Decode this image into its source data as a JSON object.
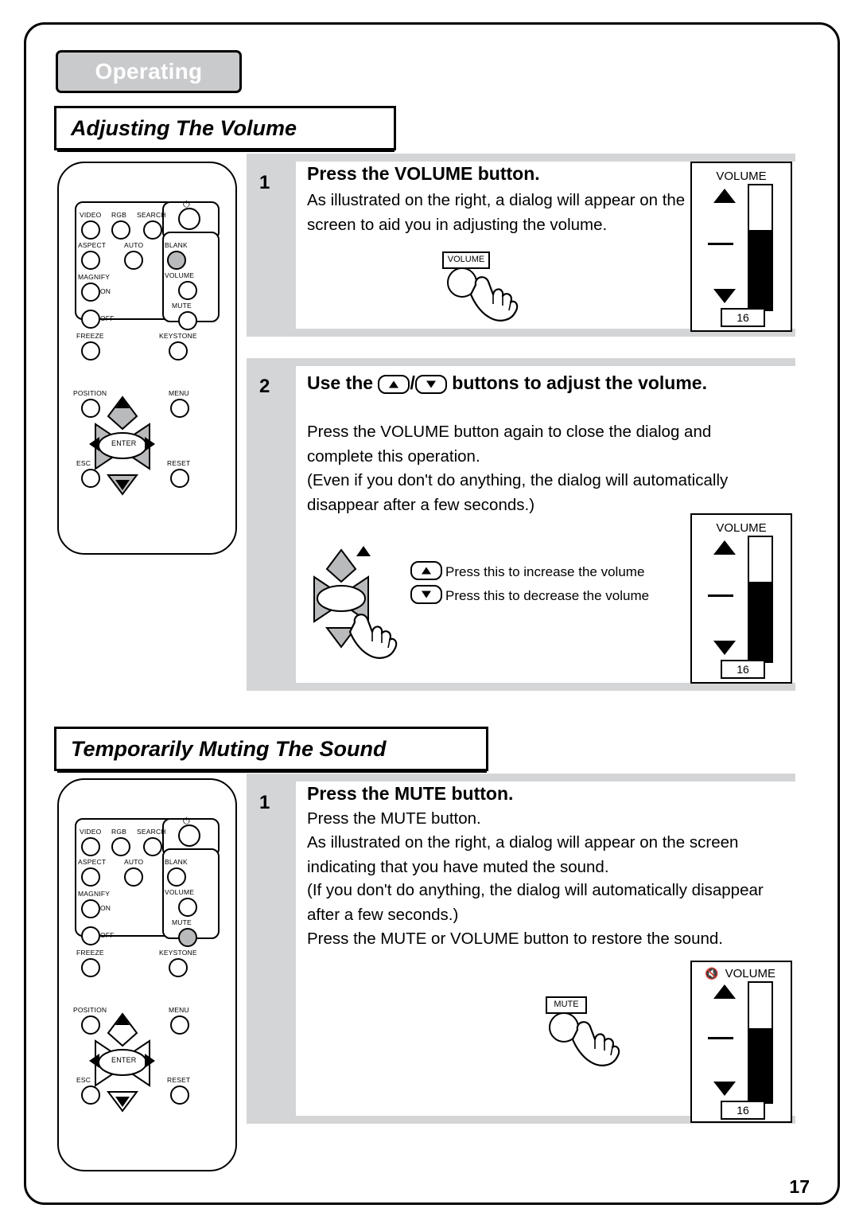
{
  "document": {
    "chapter": "Operating",
    "page_number": "17"
  },
  "sections": [
    {
      "id": "volume",
      "title": "Adjusting The Volume"
    },
    {
      "id": "mute",
      "title": "Temporarily Muting The Sound"
    }
  ],
  "steps": {
    "volume_step1": {
      "number": "1",
      "heading": "Press the VOLUME button.",
      "body": "As illustrated on the right, a dialog will appear on the screen to aid you in adjusting the volume."
    },
    "volume_step2": {
      "number": "2",
      "heading_pre": "Use the ",
      "heading_mid": "/",
      "heading_post": " buttons to adjust the volume.",
      "body_line1": "Press the VOLUME button again to close the dialog and complete this operation.",
      "body_line2": "(Even if you don't do anything, the dialog will automatically disappear after a few seconds.)",
      "legend_up": "Press this to increase the volume",
      "legend_down": "Press this to decrease the volume"
    },
    "mute_step1": {
      "number": "1",
      "heading": "Press the MUTE button.",
      "body_line1": "Press the MUTE button.",
      "body_line2": "As illustrated on the right, a dialog will appear on the screen indicating that you have muted the sound.",
      "body_line3": "(If you don't do anything, the dialog will automatically disappear after a few seconds.)",
      "body_line4": "Press the MUTE or VOLUME button to restore the sound."
    }
  },
  "callouts": {
    "volume_button_label": "VOLUME",
    "mute_button_label": "MUTE"
  },
  "osd": {
    "volume_title": "VOLUME",
    "volume_value": "16",
    "mute_title": "VOLUME",
    "mute_value": "16",
    "mute_icon": "speaker-muted-icon"
  },
  "remote": {
    "labels": {
      "video": "VIDEO",
      "rgb": "RGB",
      "search": "SEARCH",
      "power": "power-icon",
      "aspect": "ASPECT",
      "auto": "AUTO",
      "blank": "BLANK",
      "magnify": "MAGNIFY",
      "on": "ON",
      "off": "OFF",
      "volume": "VOLUME",
      "mute": "MUTE",
      "freeze": "FREEZE",
      "keystone": "KEYSTONE",
      "position": "POSITION",
      "menu": "MENU",
      "enter": "ENTER",
      "esc": "ESC",
      "reset": "RESET"
    }
  },
  "colors": {
    "tab_gray": "#c9cacc",
    "panel_gray": "#d4d5d7",
    "highlight_gray": "#b9babc",
    "ink": "#000000"
  }
}
